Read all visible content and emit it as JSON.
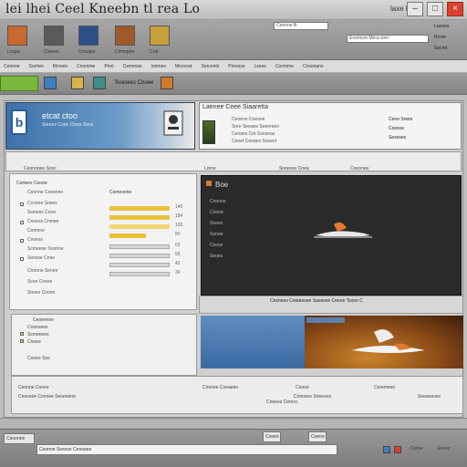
{
  "window": {
    "title": "lei lhei Ceel Kneebn tl rea Lo",
    "tag": "laxe lpe",
    "buttons": [
      "–",
      "□",
      "×"
    ]
  },
  "ribbon": {
    "icons": [
      {
        "name": "orange-app-icon",
        "color": "#c8692f"
      },
      {
        "name": "dark-media-icon",
        "color": "#5a5a5a"
      },
      {
        "name": "blue-document-icon",
        "color": "#2e4f8a"
      },
      {
        "name": "orange-photo-icon",
        "color": "#a05a2a"
      },
      {
        "name": "yellow-folder-icon",
        "color": "#c9a13a"
      }
    ],
    "labels": [
      "Lcopu",
      "Ciswen",
      "Coxupw",
      "Cimmpee",
      "Crat"
    ],
    "field_texts": [
      "Ceonne llt",
      "Enomom Mess tom"
    ],
    "right_labels": [
      "Luoees",
      "Rcme",
      "Secntt"
    ]
  },
  "menu": {
    "items": [
      "Ceonne",
      "Sorrtes",
      "Mrcees",
      "Cnomme",
      "Pnet",
      "Cwmmas",
      "Ionmes",
      "Mncesst",
      "Sercents",
      "Pnresse",
      "Lsees",
      "Cocmme",
      "Cnsonans"
    ]
  },
  "toolbar": {
    "label": "Svasees Cnoee",
    "icons": [
      "blue-square-icon",
      "yellow-square-icon",
      "teal-square-icon",
      "orange-square-icon"
    ]
  },
  "promo": {
    "title": "etcat ctoo",
    "subtitle": "Serees Cooe Cteos Seos",
    "badge": "b"
  },
  "info": {
    "title": "Laenee Ceee Siaaretta",
    "lines": [
      "Ceoenn Cneone",
      "Sere Seeaes Seeereee",
      "Cenaes Cet Sonseas",
      "Cnnet Ceeaes Snoent"
    ],
    "right": [
      "Ceoo Srees",
      "Cooess",
      "Seseses"
    ]
  },
  "tabs": {
    "items": [
      "Ceonnnee Sooc",
      "Lorne",
      "Sooesss Cnea",
      "Cnoonee"
    ]
  },
  "form": {
    "header": "Cortees Ceooe",
    "labels": [
      "Ceonne Ceeonne",
      "Ccnooe Soees",
      "Ssmess Cnoe",
      "Cnoess Cnmee",
      "Coemne",
      "Cnoess",
      "Scmeese Snonne",
      "Sensse Cooe",
      "Cnoone Senee",
      "Scoe Cnees",
      "Soees Coono"
    ],
    "right_header": "Cemesnne",
    "values": [
      "140",
      "184",
      "105",
      "80",
      "63",
      "55",
      "42",
      "36"
    ]
  },
  "preview": {
    "title": "Boe",
    "items": [
      "Ceonne",
      "Cnooe",
      "Snees",
      "Sonee",
      "Cnnse",
      "Seoes"
    ]
  },
  "caption": {
    "text": "Cesnees Coetaesee Saeesse Ceeoe Tsooo C"
  },
  "list": {
    "items": [
      "Ceoeenne",
      "Cnoeseee",
      "Scmenees",
      "Cnoee",
      "Cnnee Sos"
    ]
  },
  "lower": {
    "left": [
      "Ceonne Cnoee",
      "Cnoesee Coonee Seseeeno"
    ],
    "mid": [
      "Cnooee Coeaeee",
      "Cneees Cerecc"
    ],
    "right": [
      "Cnooe",
      "Cneoece Sneeees"
    ],
    "far": [
      "Cemmeeo",
      "Seeaeeses"
    ]
  },
  "taskbar": {
    "items": [
      "Ceoonne",
      "Coees",
      "Coeoe"
    ],
    "tray": [
      "Crone",
      "Eonor"
    ],
    "field": "Ceonne Seesse Ceooaee"
  },
  "colors": {
    "accent": "#3d71a8",
    "green": "#78b83b",
    "highlight": "#e8c13b"
  }
}
